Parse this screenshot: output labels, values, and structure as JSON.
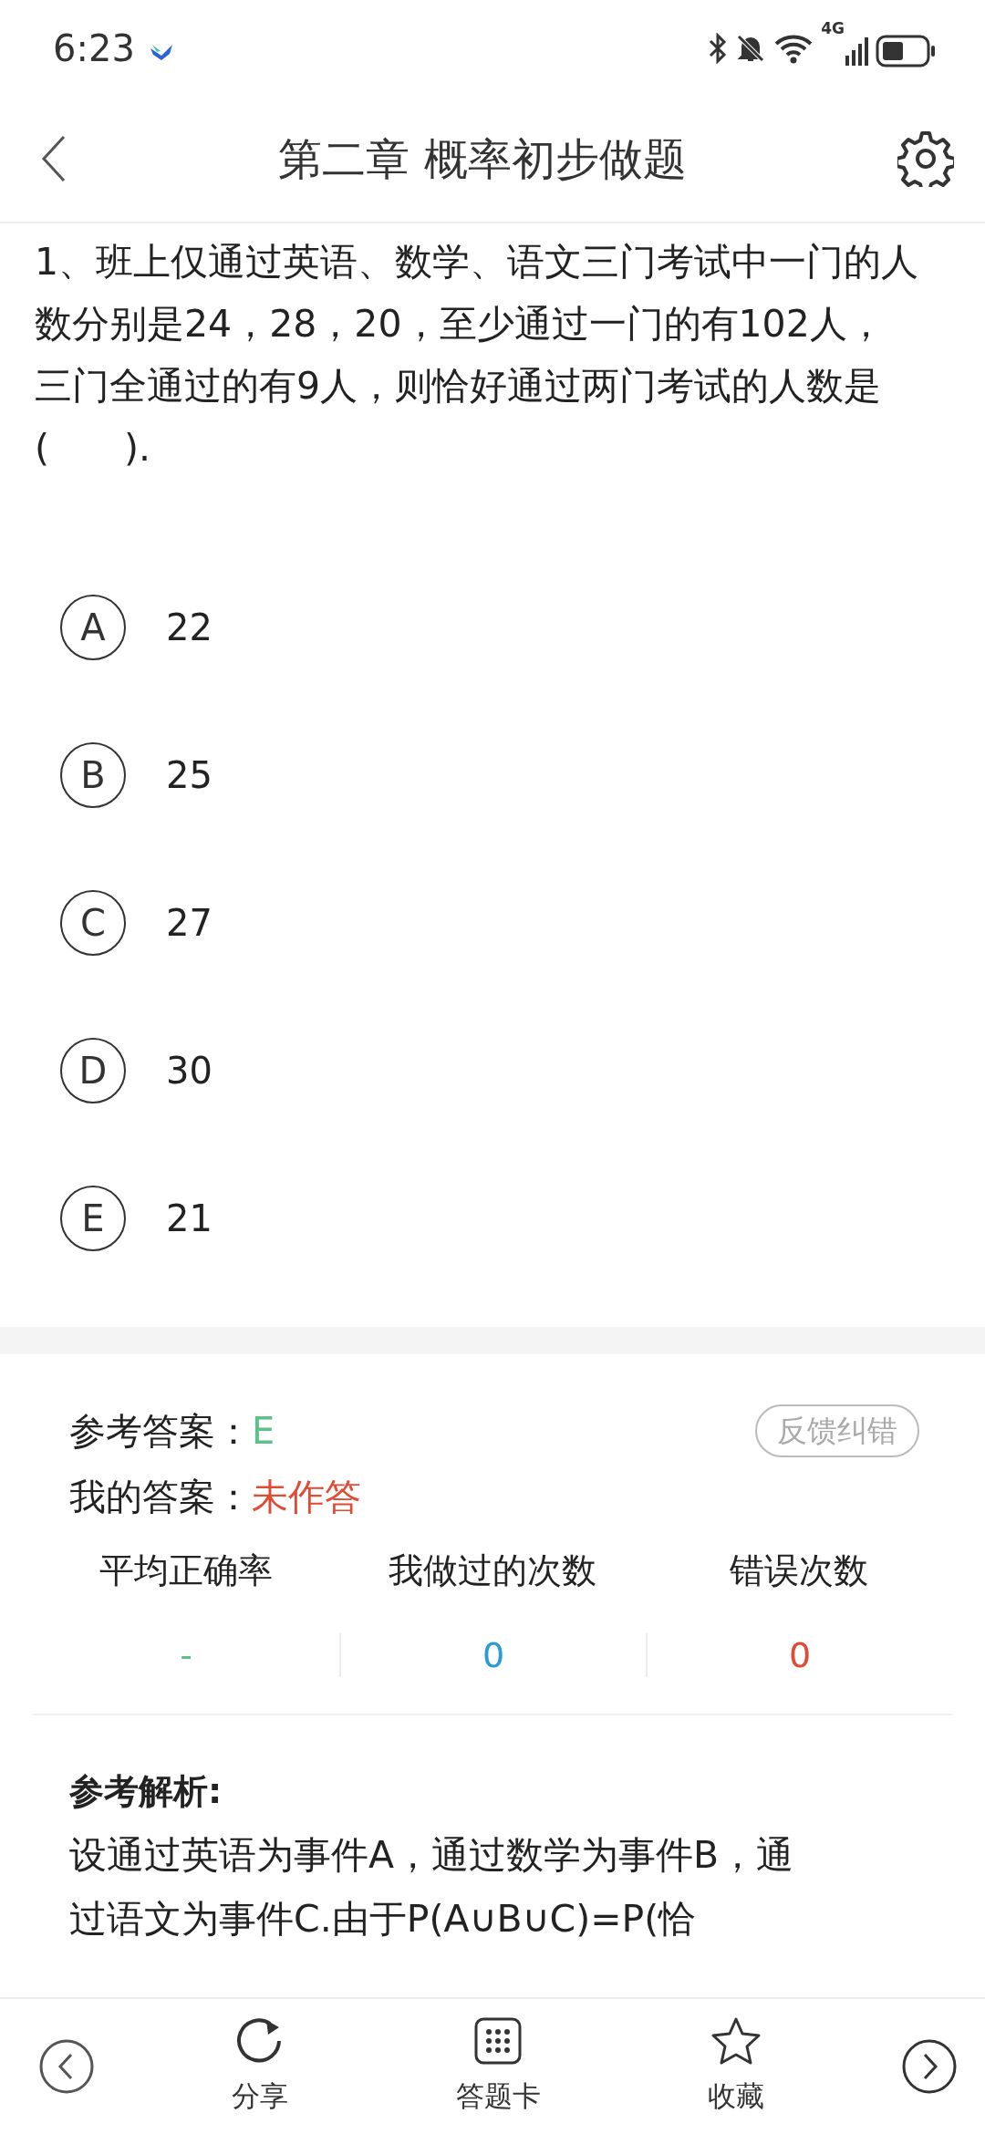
{
  "status_bar": {
    "time": "6:23",
    "network": "4G"
  },
  "header": {
    "title": "第二章 概率初步做题"
  },
  "question": {
    "text": "1、班上仅通过英语、数学、语文三门考试中一门的人数分别是24，28，20，至少通过一门的有102人，三门全通过的有9人，则恰好通过两门考试的人数是(　　)."
  },
  "options": [
    {
      "letter": "A",
      "text": "22",
      "selected": false
    },
    {
      "letter": "B",
      "text": "25",
      "selected": false
    },
    {
      "letter": "C",
      "text": "27",
      "selected": false
    },
    {
      "letter": "D",
      "text": "30",
      "selected": false
    },
    {
      "letter": "E",
      "text": "21",
      "selected": false
    }
  ],
  "answer": {
    "reference_label": "参考答案：",
    "reference": "E",
    "mine_label": "我的答案：",
    "mine": "未作答",
    "feedback_button": "反馈纠错"
  },
  "stats": [
    {
      "label": "平均正确率",
      "value": "-",
      "color": "#5cc08a"
    },
    {
      "label": "我做过的次数",
      "value": "0",
      "color": "#2a9ad8"
    },
    {
      "label": "错误次数",
      "value": "0",
      "color": "#e04b36"
    }
  ],
  "analysis": {
    "title": "参考解析:",
    "text": "设通过英语为事件A，通过数学为事件B，通过语文为事件C.由于P(A∪B∪C)=P(恰"
  },
  "bottom_nav": [
    {
      "kind": "prev"
    },
    {
      "kind": "share",
      "label": "分享"
    },
    {
      "kind": "card",
      "label": "答题卡"
    },
    {
      "kind": "favorite",
      "label": "收藏"
    },
    {
      "kind": "next"
    }
  ]
}
